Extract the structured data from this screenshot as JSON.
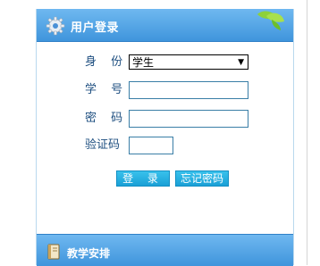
{
  "login_panel": {
    "title": "用户登录",
    "identity": {
      "label": "身 份",
      "selected": "学生"
    },
    "student_id": {
      "label": "学 号",
      "value": ""
    },
    "password": {
      "label": "密 码",
      "value": ""
    },
    "captcha": {
      "label": "验证码",
      "value": ""
    },
    "login_button": "登 录",
    "forgot_button": "忘记密码"
  },
  "schedule_section": {
    "title": "教学安排"
  },
  "colors": {
    "header": "#3f95dc",
    "label": "#1e4f80",
    "button": "#1aa0d6"
  }
}
